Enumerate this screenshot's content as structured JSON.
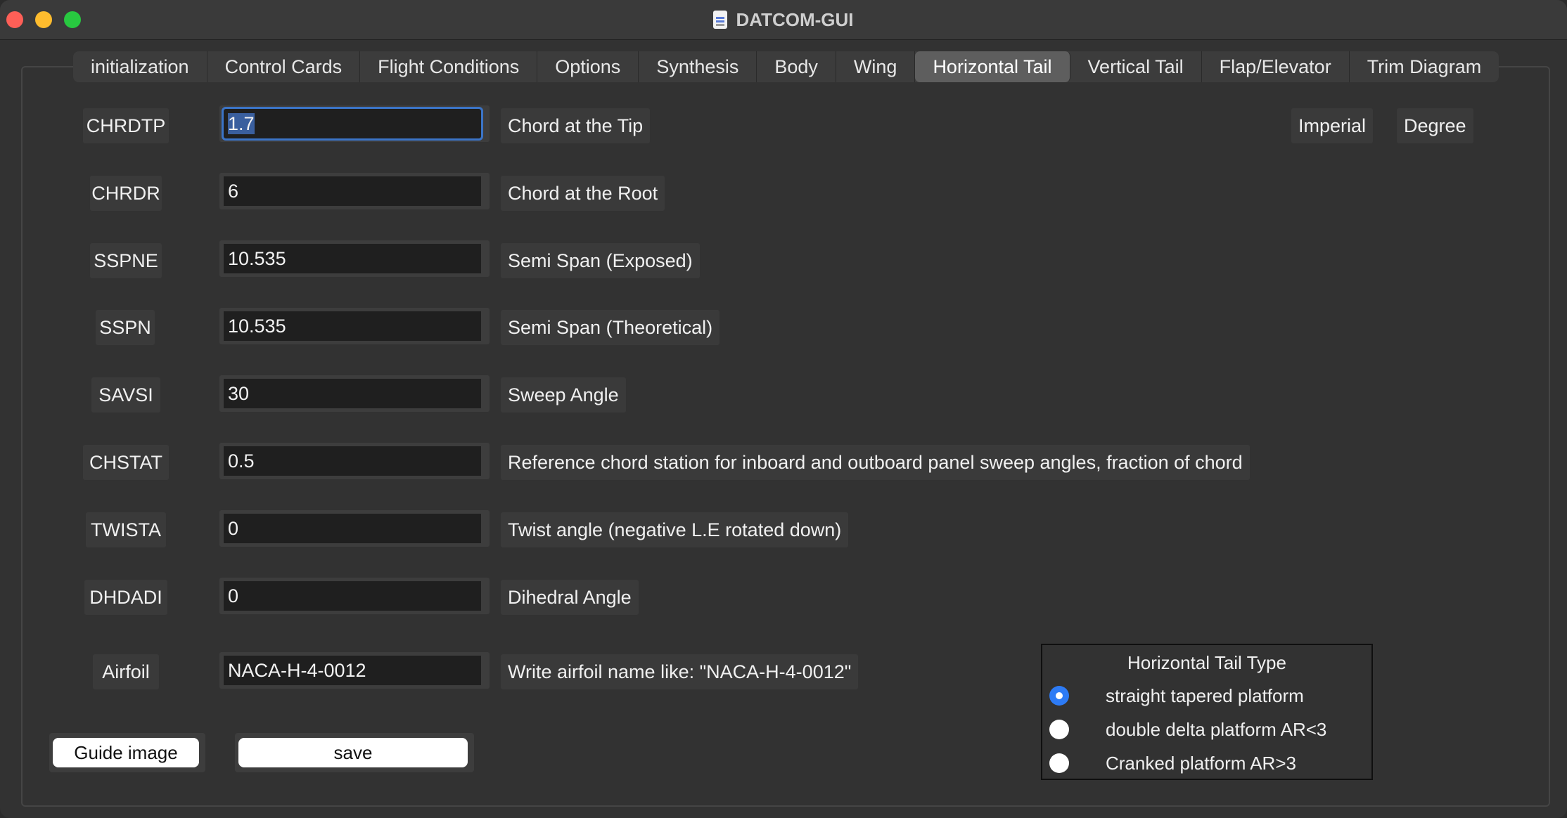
{
  "window": {
    "title": "DATCOM-GUI"
  },
  "tabs": [
    {
      "label": "initialization",
      "active": false
    },
    {
      "label": "Control Cards",
      "active": false
    },
    {
      "label": "Flight Conditions",
      "active": false
    },
    {
      "label": "Options",
      "active": false
    },
    {
      "label": "Synthesis",
      "active": false
    },
    {
      "label": "Body",
      "active": false
    },
    {
      "label": "Wing",
      "active": false
    },
    {
      "label": "Horizontal Tail",
      "active": true
    },
    {
      "label": "Vertical Tail",
      "active": false
    },
    {
      "label": "Flap/Elevator",
      "active": false
    },
    {
      "label": "Trim Diagram",
      "active": false
    }
  ],
  "units": {
    "system": "Imperial",
    "angle": "Degree"
  },
  "rows": [
    {
      "label": "CHRDTP",
      "value": "1.7",
      "description": "Chord at the Tip"
    },
    {
      "label": "CHRDR",
      "value": "6",
      "description": "Chord at the Root"
    },
    {
      "label": "SSPNE",
      "value": "10.535",
      "description": "Semi Span (Exposed)"
    },
    {
      "label": "SSPN",
      "value": "10.535",
      "description": "Semi Span (Theoretical)"
    },
    {
      "label": "SAVSI",
      "value": "30",
      "description": "Sweep Angle"
    },
    {
      "label": "CHSTAT",
      "value": "0.5",
      "description": "Reference chord station for inboard and outboard panel sweep angles, fraction of chord"
    },
    {
      "label": "TWISTA",
      "value": "0",
      "description": "Twist angle (negative L.E rotated down)"
    },
    {
      "label": "DHDADI",
      "value": "0",
      "description": "Dihedral Angle"
    },
    {
      "label": "Airfoil",
      "value": "NACA-H-4-0012",
      "description": "Write airfoil name like: \"NACA-H-4-0012\""
    }
  ],
  "buttons": {
    "guide": "Guide image",
    "save": "save"
  },
  "tail_type": {
    "title": "Horizontal Tail Type",
    "options": [
      {
        "label": "straight tapered platform",
        "checked": true
      },
      {
        "label": "double delta platform AR<3",
        "checked": false
      },
      {
        "label": "Cranked platform AR>3",
        "checked": false
      }
    ]
  },
  "colors": {
    "accent": "#2d7bf5",
    "focus": "#3b74c7",
    "active_tab": "#5e5e5e"
  }
}
